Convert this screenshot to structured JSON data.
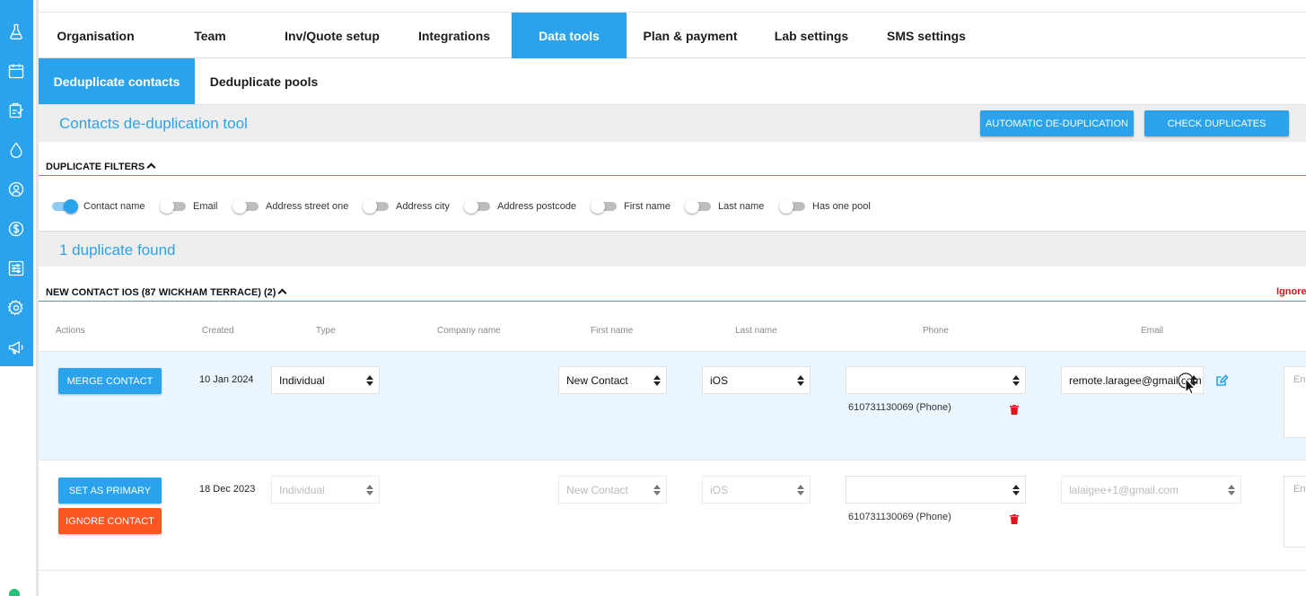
{
  "nav": {
    "tabs": [
      {
        "label": "Organisation"
      },
      {
        "label": "Team"
      },
      {
        "label": "Inv/Quote setup"
      },
      {
        "label": "Integrations"
      },
      {
        "label": "Data tools",
        "active": true
      },
      {
        "label": "Plan & payment"
      },
      {
        "label": "Lab settings"
      },
      {
        "label": "SMS settings"
      }
    ]
  },
  "subtabs": [
    {
      "label": "Deduplicate contacts",
      "active": true
    },
    {
      "label": "Deduplicate pools"
    }
  ],
  "tool": {
    "title": "Contacts de-duplication tool",
    "auto_label": "AUTOMATIC DE-DUPLICATION",
    "check_label": "CHECK DUPLICATES"
  },
  "filters": {
    "header": "DUPLICATE FILTERS",
    "items": [
      {
        "label": "Contact name",
        "on": true
      },
      {
        "label": "Email",
        "on": false
      },
      {
        "label": "Address street one",
        "on": false
      },
      {
        "label": "Address city",
        "on": false
      },
      {
        "label": "Address postcode",
        "on": false
      },
      {
        "label": "First name",
        "on": false
      },
      {
        "label": "Last name",
        "on": false
      },
      {
        "label": "Has one pool",
        "on": false
      }
    ]
  },
  "found_text": "1 duplicate found",
  "group": {
    "title": "NEW CONTACT IOS (87 WICKHAM TERRACE) (2)",
    "ignore_label": "Ignore"
  },
  "columns": {
    "actions": "Actions",
    "created": "Created",
    "type": "Type",
    "company": "Company name",
    "first_name": "First name",
    "last_name": "Last name",
    "phone": "Phone",
    "email": "Email"
  },
  "rows": [
    {
      "action_label": "MERGE CONTACT",
      "created": "10 Jan 2024",
      "type": "Individual",
      "first_name": "New Contact",
      "last_name": "iOS",
      "phone": "",
      "phone_note": "610731130069 (Phone)",
      "email": "remote.laragee@gmail.com",
      "notes_placeholder": "Enter address"
    },
    {
      "primary_label": "SET AS PRIMARY",
      "ignore_label": "IGNORE CONTACT",
      "created": "18 Dec 2023",
      "type": "Individual",
      "first_name": "New Contact",
      "last_name": "iOS",
      "phone": "",
      "phone_note": "610731130069 (Phone)",
      "email": "lalaigee+1@gmail.com",
      "notes_placeholder": "Enter address"
    }
  ],
  "icons": {
    "sidebar": [
      "flask-icon",
      "calendar-icon",
      "clipboard-check-icon",
      "water-drop-icon",
      "user-circle-icon",
      "dollar-circle-icon",
      "sliders-icon",
      "gear-icon",
      "megaphone-icon"
    ],
    "accent": "#2aa3ec",
    "danger": "#e0141b",
    "orange": "#fc5722"
  }
}
